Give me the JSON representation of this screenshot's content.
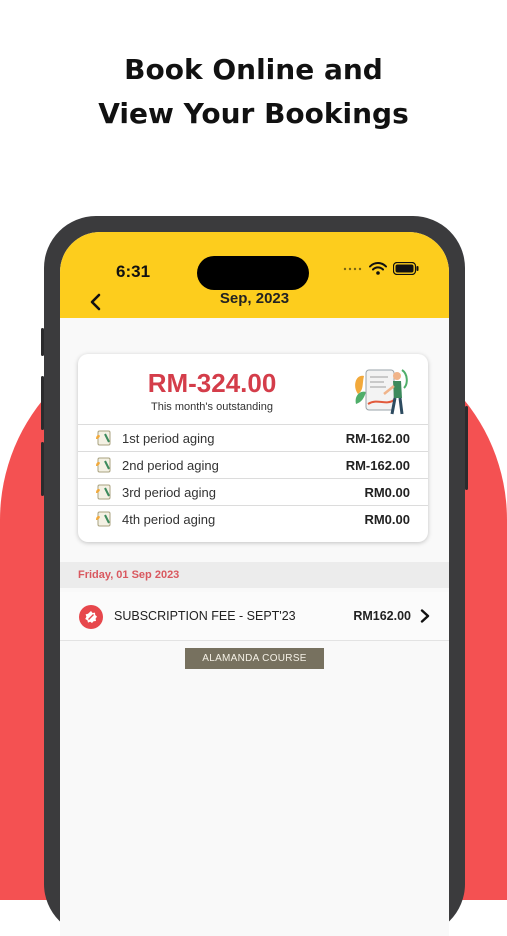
{
  "promo": {
    "title_line1": "Book Online and",
    "title_line2": "View Your Bookings"
  },
  "status_bar": {
    "time": "6:31"
  },
  "header": {
    "title": "Sep, 2023"
  },
  "summary": {
    "amount": "RM-324.00",
    "label": "This month's outstanding",
    "aging": [
      {
        "label": "1st period aging",
        "value": "RM-162.00"
      },
      {
        "label": "2nd period aging",
        "value": "RM-162.00"
      },
      {
        "label": "3rd period aging",
        "value": "RM0.00"
      },
      {
        "label": "4th period aging",
        "value": "RM0.00"
      }
    ]
  },
  "transactions": {
    "date": "Friday, 01 Sep 2023",
    "items": [
      {
        "name": "SUBSCRIPTION FEE - SEPT'23",
        "amount": "RM162.00",
        "course": "ALAMANDA COURSE"
      }
    ]
  },
  "colors": {
    "accent_yellow": "#fdcd1d",
    "background_red": "#f45152",
    "amount_red": "#d43d4a",
    "course_tag": "#77715f"
  }
}
